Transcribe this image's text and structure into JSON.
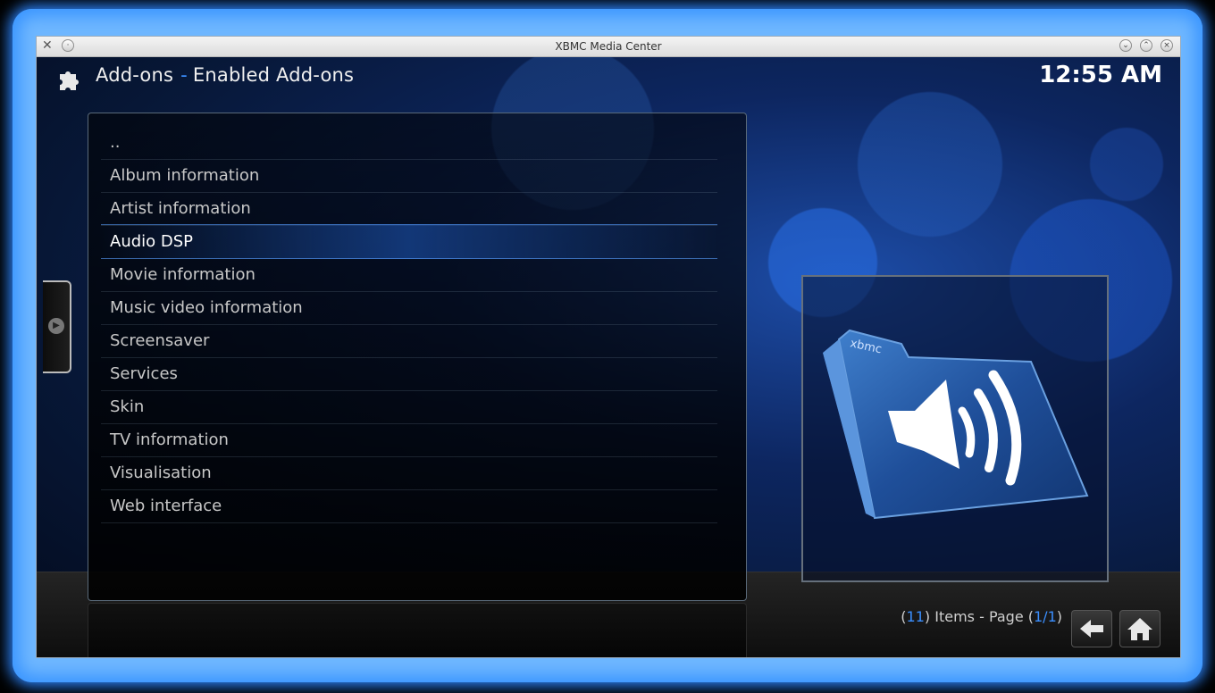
{
  "window": {
    "title": "XBMC Media Center",
    "buttons": [
      "minimize-button",
      "maximize-button",
      "close-button"
    ]
  },
  "header": {
    "section": "Add-ons",
    "separator": "-",
    "subsection": "Enabled Add-ons",
    "clock": "12:55 AM",
    "icon": "puzzle-icon"
  },
  "list": {
    "items": [
      "..",
      "Album information",
      "Artist information",
      "Audio DSP",
      "Movie information",
      "Music video information",
      "Screensaver",
      "Services",
      "Skin",
      "TV information",
      "Visualisation",
      "Web interface"
    ],
    "selected_index": 3
  },
  "thumbnail": {
    "icon": "audio-folder-icon",
    "folder_label": "xbmc"
  },
  "footer": {
    "open_paren": "(",
    "count": "11",
    "items_text": ") Items - Page (",
    "page": "1/1",
    "close_paren": ")",
    "back_icon": "back-arrow-icon",
    "home_icon": "home-icon"
  },
  "colors": {
    "accent": "#3b8fff",
    "text": "#c8c8c8"
  }
}
